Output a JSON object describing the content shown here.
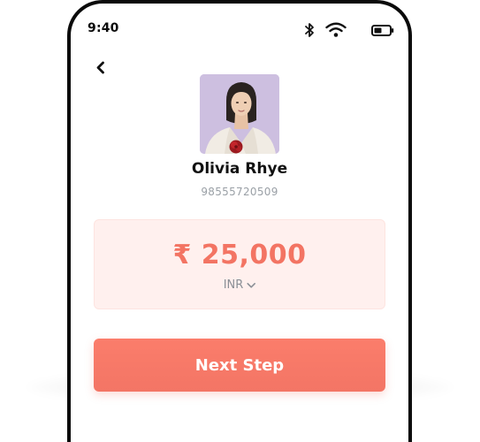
{
  "status_bar": {
    "time": "9:40"
  },
  "profile": {
    "name": "Olivia Rhye",
    "phone": "98555720509"
  },
  "payment": {
    "amount": "₹ 25,000",
    "currency": "INR"
  },
  "actions": {
    "next_label": "Next Step"
  },
  "colors": {
    "accent": "#f37463",
    "card_bg": "#fff0ee",
    "avatar_bg": "#cdbfe0"
  }
}
